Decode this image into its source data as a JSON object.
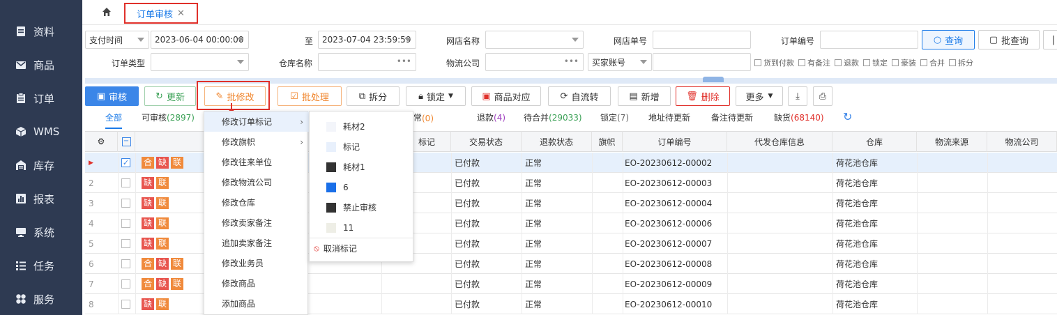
{
  "sidebar": {
    "items": [
      {
        "label": "资料",
        "icon": "document-icon"
      },
      {
        "label": "商品",
        "icon": "mail-icon"
      },
      {
        "label": "订单",
        "icon": "clipboard-icon"
      },
      {
        "label": "WMS",
        "icon": "cube-icon"
      },
      {
        "label": "库存",
        "icon": "warehouse-icon"
      },
      {
        "label": "报表",
        "icon": "chart-icon"
      },
      {
        "label": "系统",
        "icon": "monitor-icon"
      },
      {
        "label": "任务",
        "icon": "list-icon"
      },
      {
        "label": "服务",
        "icon": "grid-icon"
      }
    ]
  },
  "topbar": {
    "tab_label": "订单审核",
    "tab_close": "✕"
  },
  "filters": {
    "pay_time_select": "支付时间",
    "pay_time_from": "2023-06-04 00:00:00",
    "to_label": "至",
    "pay_time_to": "2023-07-04 23:59:59",
    "shop_name_label": "网店名称",
    "shop_order_label": "网店单号",
    "order_no_label": "订单编号",
    "order_type_label": "订单类型",
    "warehouse_label": "仓库名称",
    "logistics_label": "物流公司",
    "buyer_select": "买家账号",
    "search_button": "查询",
    "batch_search_button": "批查询",
    "checks": [
      "货到付款",
      "有备注",
      "退款",
      "锁定",
      "豪装",
      "合并",
      "拆分"
    ]
  },
  "toolbar": {
    "audit": "审核",
    "update": "更新",
    "batch_edit": "批修改",
    "batch_process": "批处理",
    "split": "拆分",
    "lock": "锁定",
    "product_match": "商品对应",
    "auto_flow": "自流转",
    "add": "新增",
    "delete": "删除",
    "more": "更多"
  },
  "subtabs": [
    {
      "label": "全部",
      "count": ""
    },
    {
      "label": "可审核",
      "count": "(2897)"
    },
    {
      "label": "金额异常",
      "count": "(0)"
    },
    {
      "label": "退款",
      "count": "(4)"
    },
    {
      "label": "待合并",
      "count": "(29033)"
    },
    {
      "label": "锁定",
      "count": "(7)"
    },
    {
      "label": "地址待更新",
      "count": ""
    },
    {
      "label": "备注待更新",
      "count": ""
    },
    {
      "label": "缺货",
      "count": "(68140)"
    }
  ],
  "table": {
    "headers": {
      "mark": "标记",
      "trade_status": "交易状态",
      "refund_status": "退款状态",
      "flag": "旗帜",
      "order_no": "订单编号",
      "agent_wh": "代发仓库信息",
      "warehouse": "仓库",
      "logistics_source": "物流来源",
      "logistics_company": "物流公司"
    },
    "rows": [
      {
        "num": "",
        "checked": true,
        "tags": [
          "合",
          "缺",
          "联"
        ],
        "trade": "已付款",
        "refund": "正常",
        "order": "EO-20230612-00002",
        "wh": "荷花池仓库"
      },
      {
        "num": "2",
        "checked": false,
        "tags": [
          "缺",
          "联"
        ],
        "trade": "已付款",
        "refund": "正常",
        "order": "EO-20230612-00003",
        "wh": "荷花池仓库"
      },
      {
        "num": "3",
        "checked": false,
        "tags": [
          "缺",
          "联"
        ],
        "trade": "已付款",
        "refund": "正常",
        "order": "EO-20230612-00004",
        "wh": "荷花池仓库"
      },
      {
        "num": "4",
        "checked": false,
        "tags": [
          "缺",
          "联"
        ],
        "trade": "已付款",
        "refund": "正常",
        "order": "EO-20230612-00006",
        "wh": "荷花池仓库"
      },
      {
        "num": "5",
        "checked": false,
        "tags": [
          "缺",
          "联"
        ],
        "trade": "已付款",
        "refund": "正常",
        "order": "EO-20230612-00007",
        "wh": "荷花池仓库"
      },
      {
        "num": "6",
        "checked": false,
        "tags": [
          "合",
          "缺",
          "联"
        ],
        "trade": "已付款",
        "refund": "正常",
        "order": "EO-20230612-00008",
        "wh": "荷花池仓库"
      },
      {
        "num": "7",
        "checked": false,
        "tags": [
          "合",
          "缺",
          "联"
        ],
        "trade": "已付款",
        "refund": "正常",
        "order": "EO-20230612-00009",
        "wh": "荷花池仓库"
      },
      {
        "num": "8",
        "checked": false,
        "tags": [
          "缺",
          "联"
        ],
        "trade": "已付款",
        "refund": "正常",
        "order": "EO-20230612-00010",
        "wh": "荷花池仓库"
      }
    ]
  },
  "context_menu": {
    "items": [
      {
        "label": "修改订单标记",
        "submenu": true
      },
      {
        "label": "修改旗帜",
        "submenu": true
      },
      {
        "label": "修改往来单位",
        "submenu": false
      },
      {
        "label": "修改物流公司",
        "submenu": false
      },
      {
        "label": "修改仓库",
        "submenu": false
      },
      {
        "label": "修改卖家备注",
        "submenu": false
      },
      {
        "label": "追加卖家备注",
        "submenu": false
      },
      {
        "label": "修改业务员",
        "submenu": false
      },
      {
        "label": "修改商品",
        "submenu": false
      },
      {
        "label": "添加商品",
        "submenu": false
      }
    ],
    "submenu": [
      {
        "label": "耗材2",
        "color": "#f3f5fa"
      },
      {
        "label": "标记",
        "color": "#e8f0fc"
      },
      {
        "label": "耗材1",
        "color": "#333333"
      },
      {
        "label": "6",
        "color": "#1a6fe8"
      },
      {
        "label": "禁止审核",
        "color": "#333333"
      },
      {
        "label": "11",
        "color": "#eeeee6"
      },
      {
        "label": "取消标记",
        "color": ""
      }
    ]
  },
  "colors": {
    "accent": "#1a7ae8",
    "danger": "#e0302a",
    "sidebar": "#2e3a52",
    "selected_row": "#e6f0fc"
  }
}
